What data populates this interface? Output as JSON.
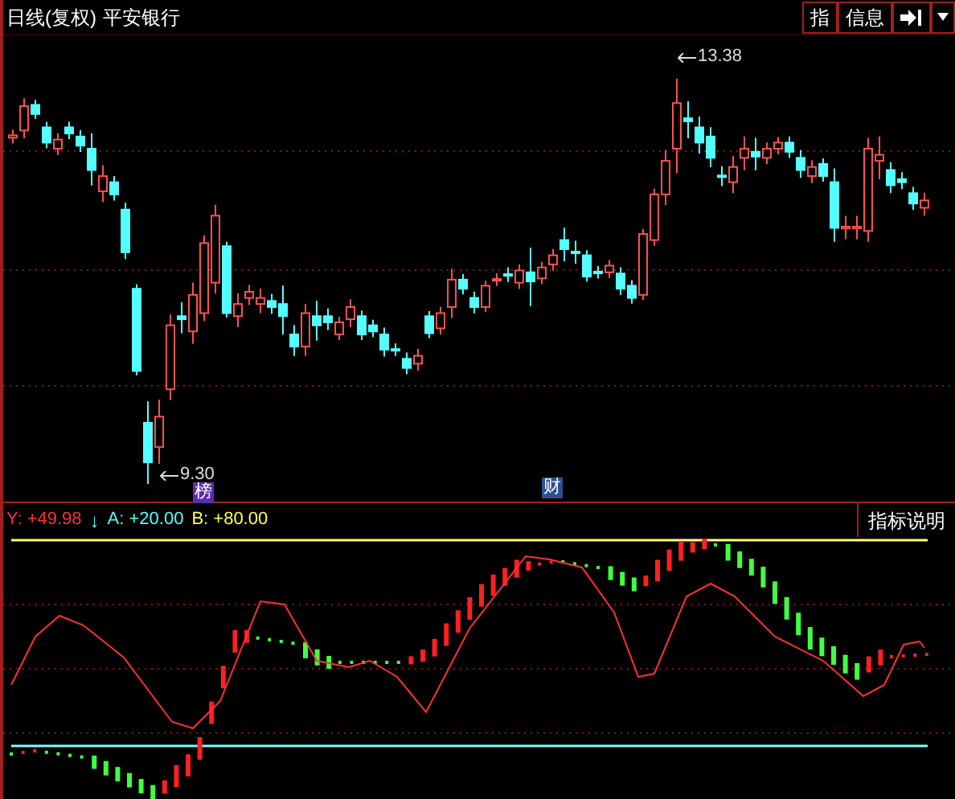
{
  "header": {
    "period": "日线(复权)",
    "stock_name": "平安银行",
    "buttons": [
      "指",
      "信息"
    ]
  },
  "price_chart": {
    "high_label": "13.38",
    "low_label": "9.30",
    "markers": [
      {
        "label": "榜",
        "color": "#5b2bb0"
      },
      {
        "label": "财",
        "color": "#2b4f8f"
      }
    ]
  },
  "indicator": {
    "y_reading": "Y: +49.98",
    "trend_arrow": "↓",
    "a_reading": "A: +20.00",
    "b_reading": "B: +80.00",
    "help_button": "指标说明"
  }
}
